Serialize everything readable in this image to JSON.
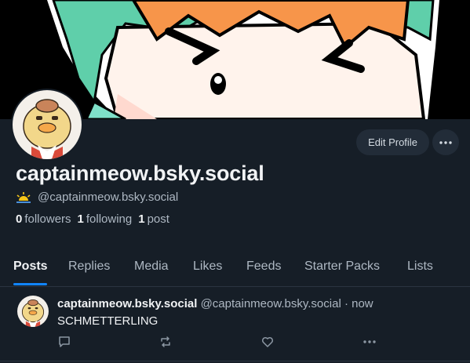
{
  "profile": {
    "display_name": "captainmeow.bsky.social",
    "handle": "@captainmeow.bsky.social",
    "handle_icon": "sun-icon",
    "stats": {
      "followers_count": "0",
      "followers_label": "followers",
      "following_count": "1",
      "following_label": "following",
      "posts_count": "1",
      "posts_label": "post"
    },
    "edit_label": "Edit Profile",
    "more_icon": "ellipsis-icon"
  },
  "tabs": [
    {
      "label": "Posts",
      "active": true
    },
    {
      "label": "Replies"
    },
    {
      "label": "Media"
    },
    {
      "label": "Likes"
    },
    {
      "label": "Feeds"
    },
    {
      "label": "Starter Packs"
    },
    {
      "label": "Lists"
    }
  ],
  "post": {
    "author": "captainmeow.bsky.social",
    "handle_time": "@captainmeow.bsky.social · now",
    "text": "SCHMETTERLING",
    "actions": [
      "reply-icon",
      "repost-icon",
      "like-icon",
      "more-icon"
    ]
  },
  "colors": {
    "background": "#161e27",
    "accent": "#1185fe",
    "muted_text": "#aeb8c3",
    "button_bg": "#222c38"
  }
}
